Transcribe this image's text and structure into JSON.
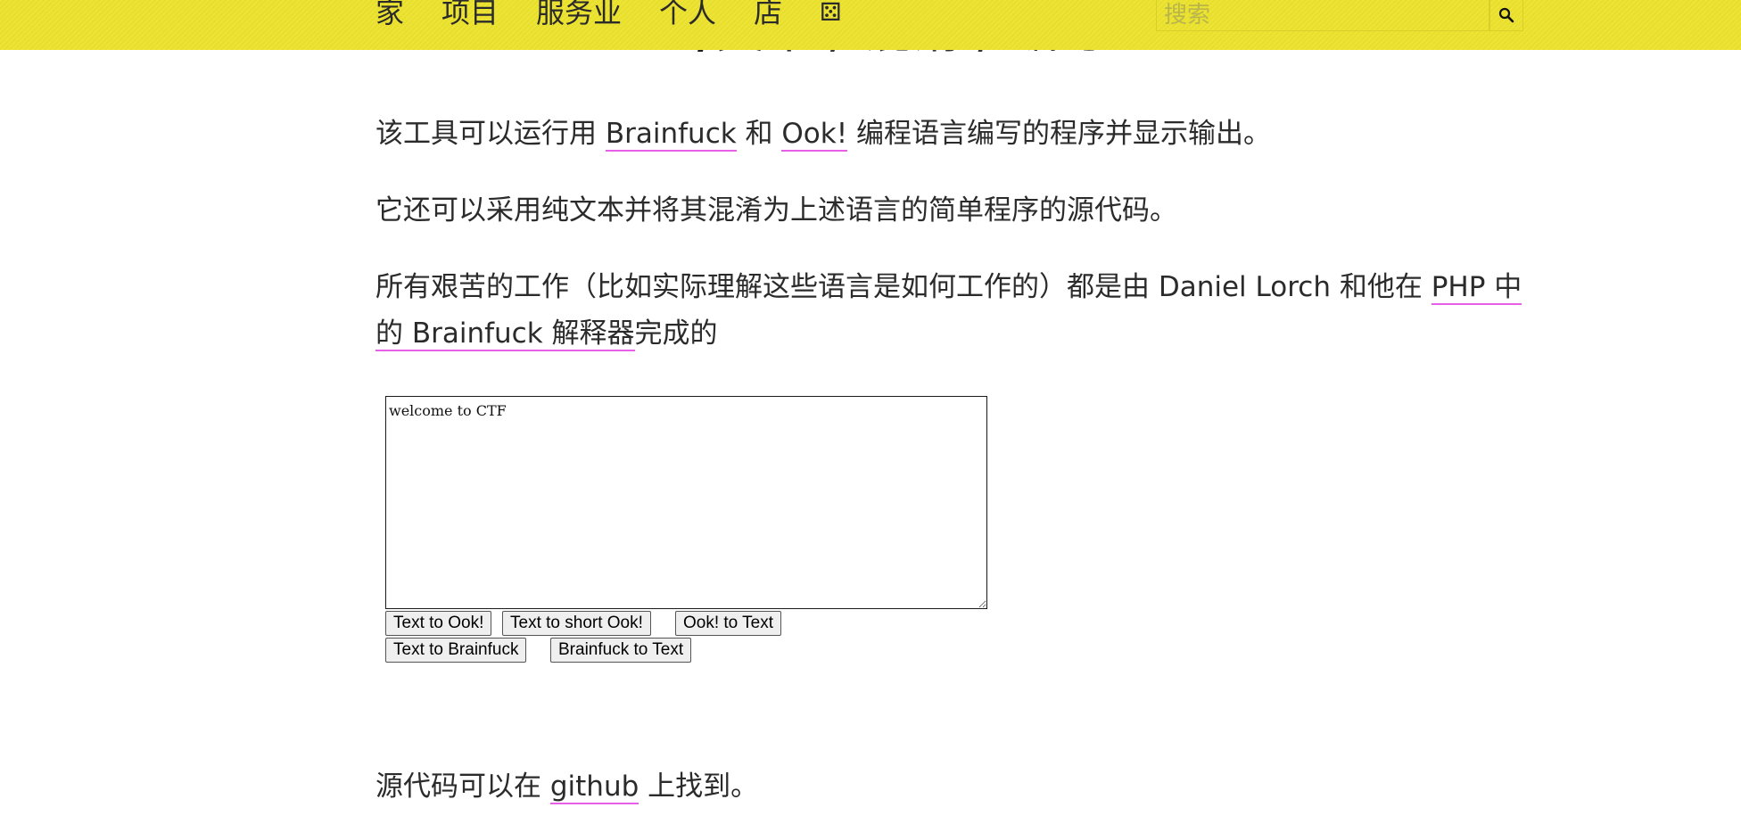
{
  "page": {
    "title_bold": "BRAINFUCK/",
    "title_rest": "文本 / 混淆 / 编写"
  },
  "nav": {
    "items": [
      "家",
      "项目",
      "服务业",
      "个人",
      "店"
    ],
    "dice_icon": "⚄",
    "search_placeholder": "搜索"
  },
  "intro": {
    "p1_a": "该工具可以运行用 ",
    "p1_link1": "Brainfuck",
    "p1_b": " 和 ",
    "p1_link2": "Ook!",
    "p1_c": " 编程语言编写的程序并显示输出。",
    "p2": "它还可以采用纯文本并将其混淆为上述语言的简单程序的源代码。",
    "p3_a": "所有艰苦的工作（比如实际理解这些语言是如何工作的）都是由 Daniel Lorch 和他在 ",
    "p3_link": "PHP 中的 Brainfuck 解释器",
    "p3_b": "完成的"
  },
  "tool": {
    "textarea_value": "welcome to CTF",
    "buttons": {
      "text_to_ook": "Text to Ook!",
      "text_to_short_ook": "Text to short Ook!",
      "ook_to_text": "Ook! to Text",
      "text_to_brainfuck": "Text to Brainfuck",
      "brainfuck_to_text": "Brainfuck to Text"
    }
  },
  "footer": {
    "source_a": "源代码可以在 ",
    "source_link": "github",
    "source_b": " 上找到。"
  },
  "colors": {
    "header_bg": "#ece22c",
    "link_underline": "#e65fe6"
  }
}
